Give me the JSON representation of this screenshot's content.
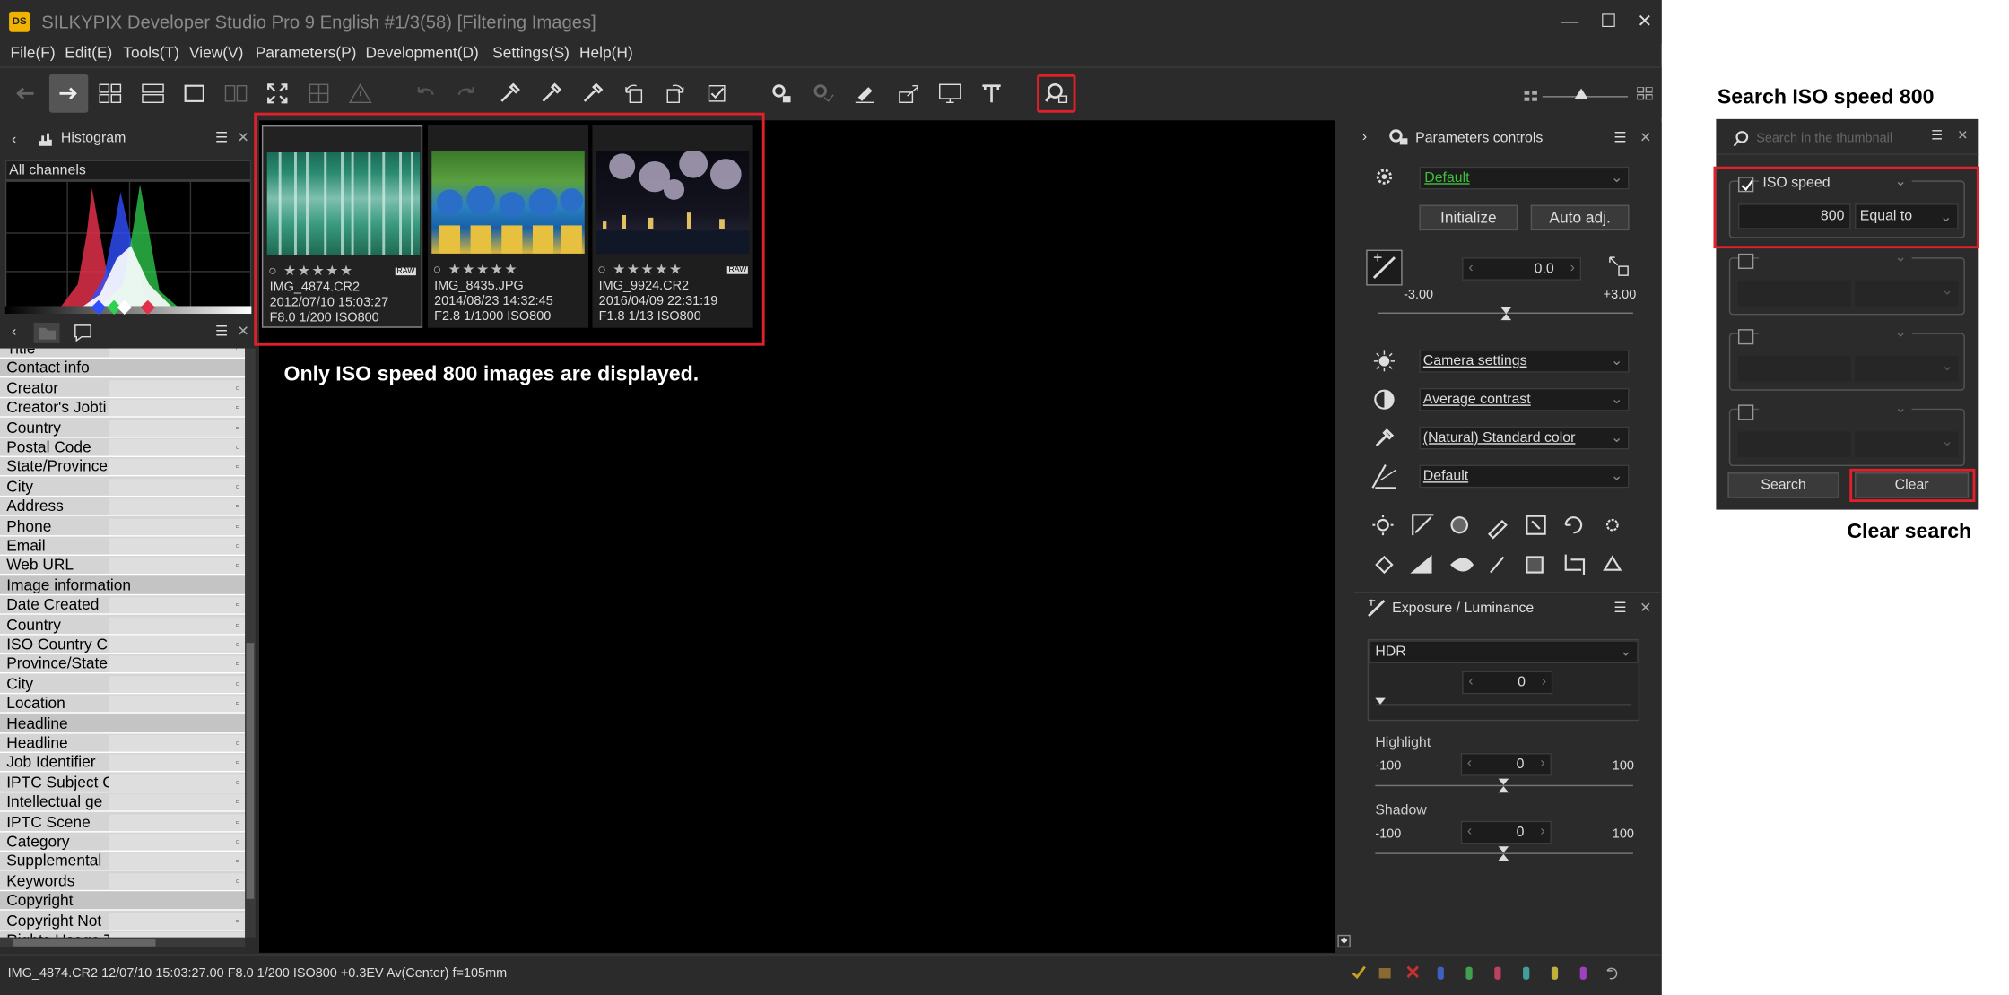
{
  "app": {
    "title": "SILKYPIX Developer Studio Pro 9 English   #1/3(58) [Filtering Images]",
    "logo_text": "DS",
    "menu": [
      "File(F)",
      "Edit(E)",
      "Tools(T)",
      "View(V)",
      "Parameters(P)",
      "Development(D)",
      "Settings(S)",
      "Help(H)"
    ]
  },
  "histogram": {
    "title": "Histogram",
    "channel": "All channels"
  },
  "metadata": {
    "rows": [
      {
        "label": "Title",
        "header": false
      },
      {
        "label": "Contact info",
        "header": true
      },
      {
        "label": "Creator",
        "header": false
      },
      {
        "label": "Creator's Jobti",
        "header": false
      },
      {
        "label": "Country",
        "header": false
      },
      {
        "label": "Postal Code",
        "header": false
      },
      {
        "label": "State/Province",
        "header": false
      },
      {
        "label": "City",
        "header": false
      },
      {
        "label": "Address",
        "header": false
      },
      {
        "label": "Phone",
        "header": false
      },
      {
        "label": "Email",
        "header": false
      },
      {
        "label": "Web URL",
        "header": false
      },
      {
        "label": "Image information",
        "header": true
      },
      {
        "label": "Date Created",
        "header": false
      },
      {
        "label": "Country",
        "header": false
      },
      {
        "label": "ISO Country C",
        "header": false
      },
      {
        "label": "Province/State",
        "header": false
      },
      {
        "label": "City",
        "header": false
      },
      {
        "label": "Location",
        "header": false
      },
      {
        "label": "Headline",
        "header": true
      },
      {
        "label": "Headline",
        "header": false
      },
      {
        "label": "Job Identifier",
        "header": false
      },
      {
        "label": "IPTC Subject C",
        "header": false
      },
      {
        "label": "Intellectual ge",
        "header": false
      },
      {
        "label": "IPTC Scene",
        "header": false
      },
      {
        "label": "Category",
        "header": false
      },
      {
        "label": "Supplemental",
        "header": false
      },
      {
        "label": "Keywords",
        "header": false
      },
      {
        "label": "Copyright",
        "header": true
      },
      {
        "label": "Copyright Not",
        "header": false
      },
      {
        "label": "Rights Usage T",
        "header": false
      }
    ]
  },
  "thumbnails": [
    {
      "name": "IMG_4874.CR2",
      "date": "2012/07/10 15:03:27",
      "info": "F8.0 1/200 ISO800",
      "raw": true,
      "selected": true
    },
    {
      "name": "IMG_8435.JPG",
      "date": "2014/08/23 14:32:45",
      "info": "F2.8 1/1000 ISO800",
      "raw": false,
      "selected": false
    },
    {
      "name": "IMG_9924.CR2",
      "date": "2016/04/09 22:31:19",
      "info": "F1.8 1/13 ISO800",
      "raw": true,
      "selected": false
    }
  ],
  "raw_badge": "RAW",
  "annotations": {
    "center": "Only ISO speed  800 images are displayed.",
    "search_title": "Search ISO speed 800",
    "clear": "Clear search"
  },
  "params": {
    "title": "Parameters controls",
    "preset": "Default",
    "initialize": "Initialize",
    "auto_adj": "Auto adj.",
    "exposure_value": "0.0",
    "exposure_min": "-3.00",
    "exposure_max": "+3.00",
    "dropdowns": [
      "Camera settings",
      "Average contrast",
      "(Natural) Standard color",
      "Default"
    ]
  },
  "exposure_panel": {
    "title": "Exposure / Luminance",
    "mode": "HDR",
    "hdr_value": "0",
    "highlight_label": "Highlight",
    "highlight_value": "0",
    "highlight_min": "-100",
    "highlight_max": "100",
    "shadow_label": "Shadow",
    "shadow_value": "0",
    "shadow_min": "-100",
    "shadow_max": "100"
  },
  "status": {
    "text": "IMG_4874.CR2 12/07/10 15:03:27.00 F8.0 1/200 ISO800 +0.3EV Av(Center) f=105mm"
  },
  "search_panel": {
    "placeholder": "Search in the thumbnail",
    "condition_label": "ISO speed",
    "condition_value": "800",
    "condition_op": "Equal to",
    "search_button": "Search",
    "clear_button": "Clear"
  },
  "colors": {
    "highlight": "#e0202a",
    "preset_green": "#3fbf3f",
    "panel_bg": "#2b2b2b"
  }
}
